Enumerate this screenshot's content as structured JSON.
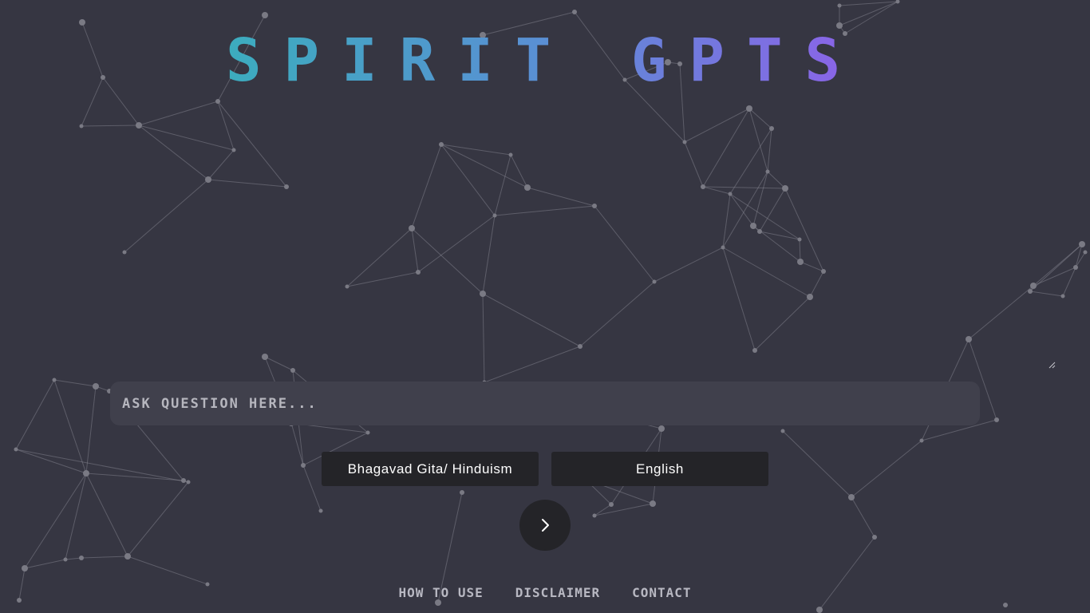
{
  "header": {
    "title": "SPIRIT GPTS"
  },
  "question": {
    "placeholder": "ASK QUESTION HERE...",
    "value": ""
  },
  "selectors": {
    "religion": "Bhagavad Gita/ Hinduism",
    "language": "English"
  },
  "submit": {
    "icon": "chevron-right-icon"
  },
  "footer": {
    "links": [
      "HOW TO USE",
      "DISCLAIMER",
      "CONTACT"
    ]
  },
  "colors": {
    "background": "#363642",
    "title_gradient_start": "#3cacbe",
    "title_gradient_end": "#8c62e8",
    "input_background": "#40404c",
    "button_background": "#242428"
  }
}
